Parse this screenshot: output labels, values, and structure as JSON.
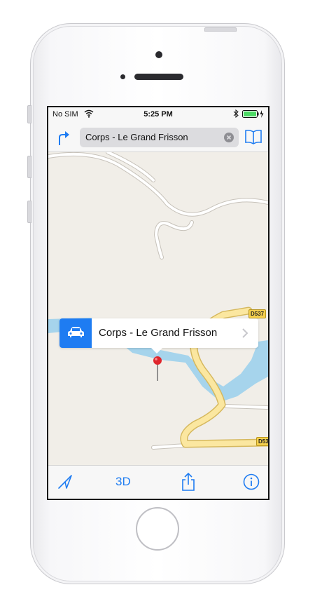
{
  "status_bar": {
    "carrier": "No SIM",
    "time": "5:25 PM"
  },
  "nav_bar": {
    "search_value": "Corps - Le Grand Frisson"
  },
  "map": {
    "callout": {
      "title": "Corps - Le Grand Frisson",
      "icon": "car-icon"
    },
    "road_labels": [
      "D537",
      "D53"
    ]
  },
  "toolbar": {
    "toggle_3d_label": "3D",
    "icons": [
      "location-arrow-icon",
      "share-icon",
      "info-icon"
    ]
  },
  "colors": {
    "accent": "#1e7cf2",
    "map_bg": "#f1eee8",
    "water": "#a6d4ec",
    "highway": "#f5d04e",
    "pin": "#e0252c"
  }
}
